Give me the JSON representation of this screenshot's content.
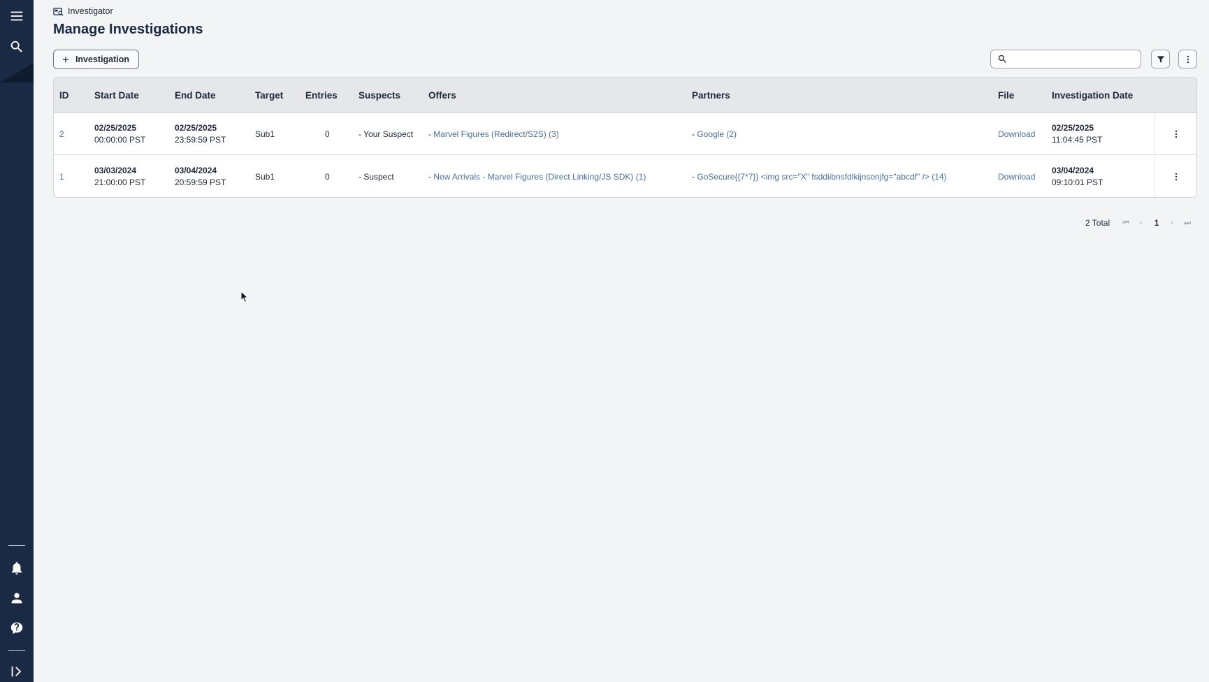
{
  "sidebar": {
    "items": [
      {
        "name": "menu-icon"
      },
      {
        "name": "search-icon"
      },
      {
        "name": "bell-icon"
      },
      {
        "name": "user-icon"
      },
      {
        "name": "help-icon"
      },
      {
        "name": "expand-sidebar-icon"
      }
    ],
    "bg_color": "#1b2a44"
  },
  "breadcrumb": {
    "label": "Investigator",
    "icon": "investigator-icon"
  },
  "page_title": "Manage Investigations",
  "toolbar": {
    "add_label": "Investigation",
    "search_placeholder": "",
    "search_value": "",
    "filter_icon": "filter-icon",
    "more_icon": "more-vertical-icon"
  },
  "table": {
    "columns": [
      "ID",
      "Start Date",
      "End Date",
      "Target",
      "Entries",
      "Suspects",
      "Offers",
      "Partners",
      "File",
      "Investigation Date"
    ],
    "rows": [
      {
        "id": "2",
        "start_date": "02/25/2025",
        "start_time": "00:00:00 PST",
        "end_date": "02/25/2025",
        "end_time": "23:59:59 PST",
        "target": "Sub1",
        "entries": "0",
        "suspects": "- Your Suspect",
        "offers_prefix": "- ",
        "offers": "Marvel Figures (Redirect/S2S) (3)",
        "partners_prefix": "- ",
        "partners": "Google (2)",
        "file": "Download",
        "inv_date": "02/25/2025",
        "inv_time": "11:04:45 PST"
      },
      {
        "id": "1",
        "start_date": "03/03/2024",
        "start_time": "21:00:00 PST",
        "end_date": "03/04/2024",
        "end_time": "20:59:59 PST",
        "target": "Sub1",
        "entries": "0",
        "suspects": "- Suspect",
        "offers_prefix": "- ",
        "offers": "New Arrivals - Marvel Figures (Direct Linking/JS SDK) (1)",
        "partners_prefix": "- ",
        "partners": "GoSecure{{7*7}} <img src=\"X\" fsddiibnsfdlkijnsonjfg=\"abcdf\" /> (14)",
        "file": "Download",
        "inv_date": "03/04/2024",
        "inv_time": "09:10:01 PST"
      }
    ]
  },
  "pagination": {
    "total": "2 Total",
    "first": "⏮",
    "prev": "‹",
    "current": "1",
    "next": "›",
    "last": "⏭"
  },
  "colors": {
    "link": "#4a6fa5",
    "header_bg": "#e5e7eb",
    "page_bg": "#f3f4f6"
  }
}
